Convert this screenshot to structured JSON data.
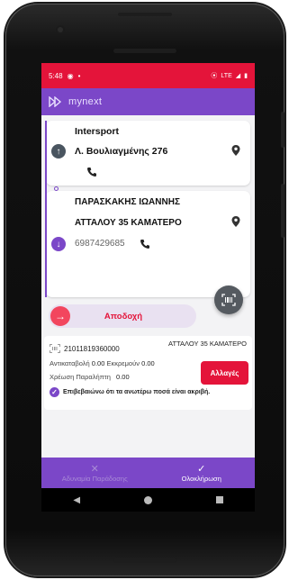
{
  "status_bar": {
    "time": "5:48",
    "network": "LTE"
  },
  "app": {
    "logo": "mynext"
  },
  "pickup": {
    "name": "Intersport",
    "address": "Λ. Βουλιαγμένης 276"
  },
  "delivery": {
    "name": "ΠΑΡΑΣΚΑΚΗΣ ΙΩΑΝΝΗΣ",
    "address": "ΑΤΤΑΛΟΥ 35 ΚΑΜΑΤΕΡΟ",
    "phone": "6987429685"
  },
  "accept_button": {
    "label": "Αποδοχή"
  },
  "shipment": {
    "address": "ΑΤΤΑΛΟΥ 35 ΚΑΜΑΤΕΡΟ",
    "code": "21011819360000",
    "cod_label": "Αντικαταβολή",
    "cod_value": "0.00",
    "pending_label": "Εκκρεμούν",
    "pending_value": "0.00",
    "recipient_charge_label": "Χρέωση Παραλήπτη",
    "recipient_charge_value": "0.00",
    "change_button": "Αλλαγές",
    "confirm_text": "Επιβεβαιώνω ότι τα ανωτέρω ποσά είναι ακριβή."
  },
  "bottom_actions": {
    "failed_label": "Αδυναμία Παράδοσης",
    "complete_label": "Ολοκλήρωση"
  },
  "colors": {
    "status_bar": "#e4143a",
    "app_bar": "#7b47c8",
    "accent_red": "#e4143a",
    "purple": "#7b47c8"
  }
}
